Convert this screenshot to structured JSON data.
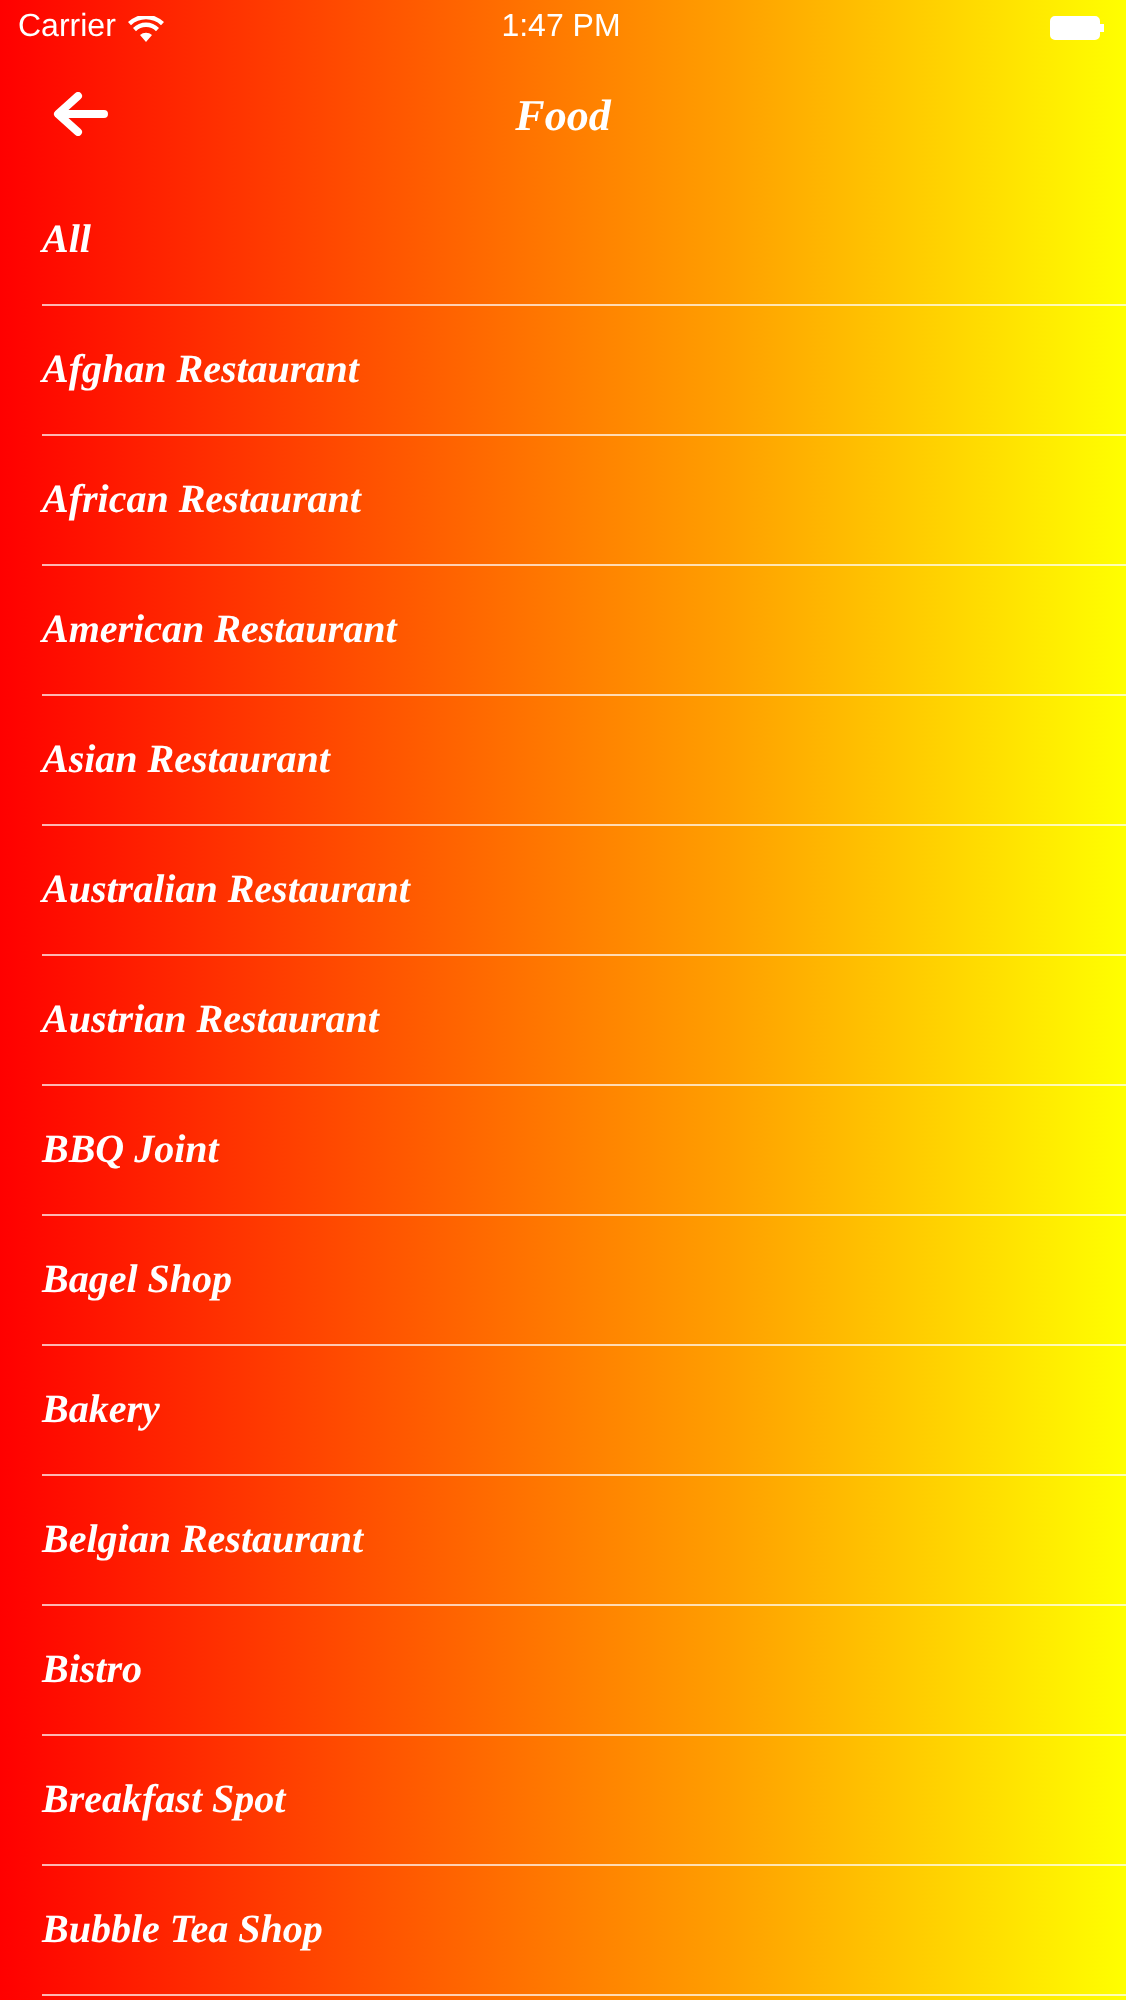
{
  "status_bar": {
    "carrier": "Carrier",
    "time": "1:47 PM"
  },
  "nav": {
    "title": "Food"
  },
  "items": [
    "All",
    "Afghan Restaurant",
    "African Restaurant",
    "American Restaurant",
    "Asian Restaurant",
    "Australian Restaurant",
    "Austrian Restaurant",
    "BBQ Joint",
    "Bagel Shop",
    "Bakery",
    "Belgian Restaurant",
    "Bistro",
    "Breakfast Spot",
    "Bubble Tea Shop"
  ]
}
